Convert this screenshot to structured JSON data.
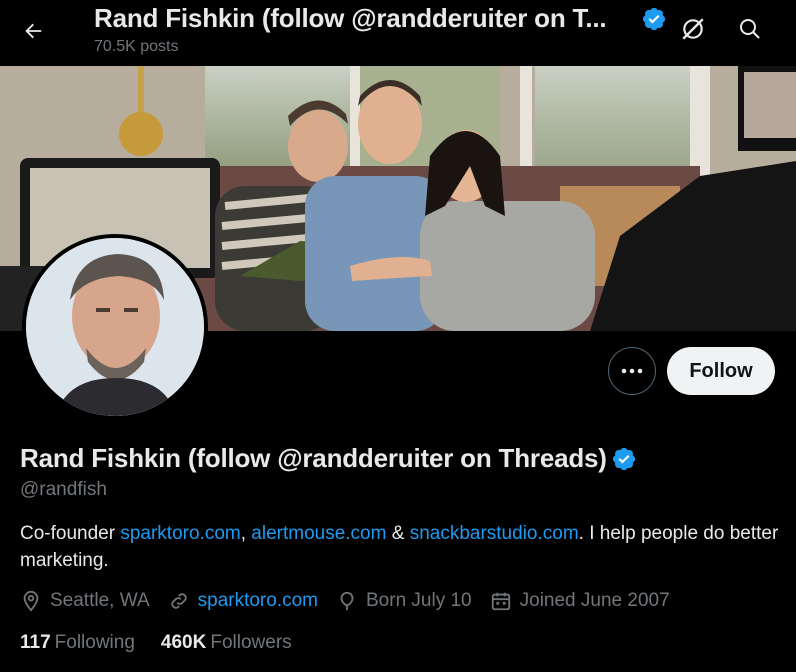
{
  "header": {
    "title": "Rand Fishkin (follow @randderuiter on T...",
    "posts": "70.5K posts"
  },
  "profile": {
    "name": "Rand Fishkin (follow @randderuiter on Threads)",
    "handle": "@randfish",
    "bio": {
      "prefix": "Co-founder ",
      "link1": "sparktoro.com",
      "sep1": ", ",
      "link2": "alertmouse.com",
      "sep2": " & ",
      "link3": "snackbarstudio.com",
      "suffix": ". I help people do better marketing."
    },
    "location": "Seattle, WA",
    "website": "sparktoro.com",
    "birthday": "Born July 10",
    "joined": "Joined June 2007",
    "following_count": "117",
    "following_label": "Following",
    "followers_count": "460K",
    "followers_label": "Followers"
  },
  "buttons": {
    "follow": "Follow"
  },
  "colors": {
    "accent": "#1d9bf0",
    "muted": "#71767b",
    "text": "#e7e9ea",
    "background": "#000000"
  },
  "icons": [
    "back-arrow-icon",
    "verified-badge-icon",
    "grok-icon",
    "search-icon",
    "more-icon",
    "location-icon",
    "link-icon",
    "birthday-icon",
    "calendar-icon"
  ]
}
